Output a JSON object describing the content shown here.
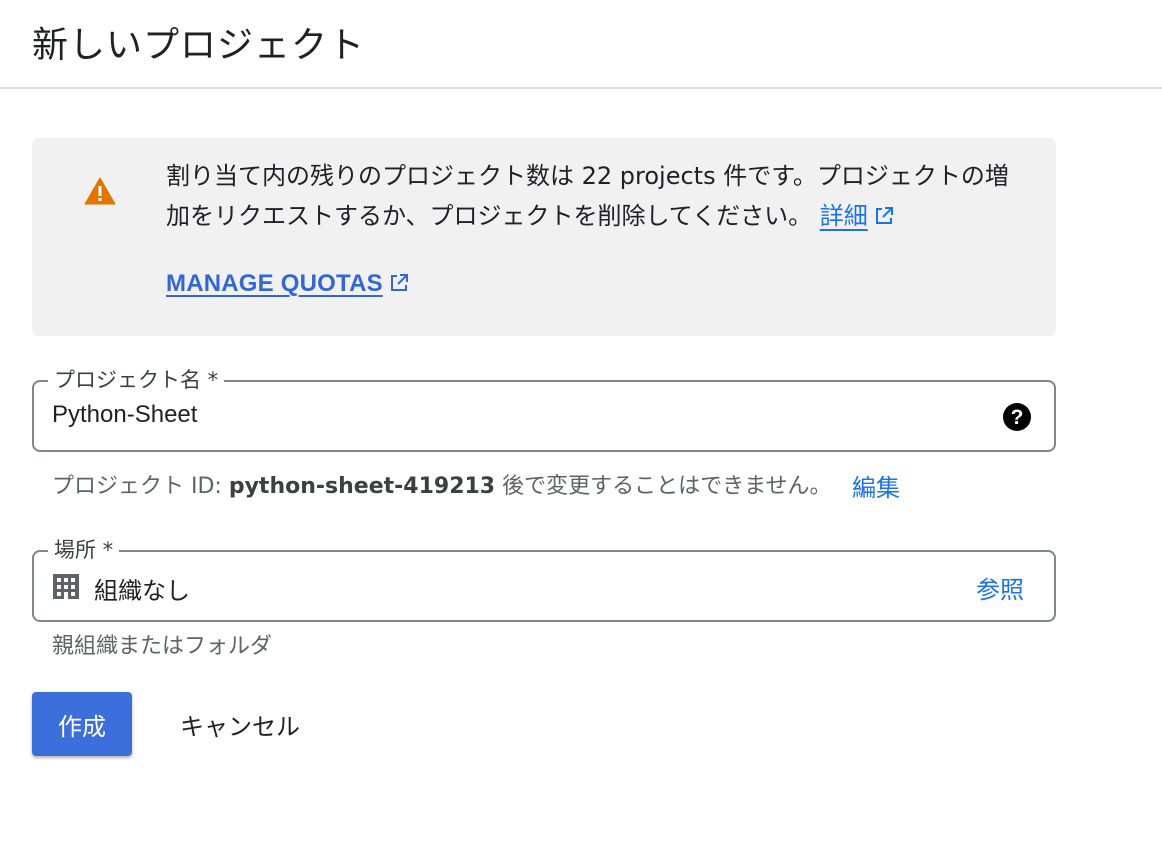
{
  "header": {
    "title": "新しいプロジェクト"
  },
  "quota": {
    "message": "割り当て内の残りのプロジェクト数は 22 projects 件です。プロジェクトの増加をリクエストするか、プロジェクトを削除してください。",
    "details_link": "詳細",
    "manage_link": "MANAGE QUOTAS"
  },
  "project_name": {
    "label": "プロジェクト名 *",
    "value": "Python-Sheet"
  },
  "project_id": {
    "prefix": "プロジェクト ID:",
    "id": "python-sheet-419213",
    "suffix": "後で変更することはできません。",
    "edit_label": "編集"
  },
  "location": {
    "label": "場所 *",
    "value": "組織なし",
    "browse_label": "参照",
    "hint": "親組織またはフォルダ"
  },
  "actions": {
    "create_label": "作成",
    "cancel_label": "キャンセル"
  },
  "colors": {
    "accent": "#1a73e8",
    "primary_button": "#3c6fdc",
    "warning": "#e37400",
    "notice_bg": "#f1f1f1"
  },
  "icons": [
    "warning-icon",
    "external-link-icon",
    "help-icon",
    "organization-icon"
  ]
}
